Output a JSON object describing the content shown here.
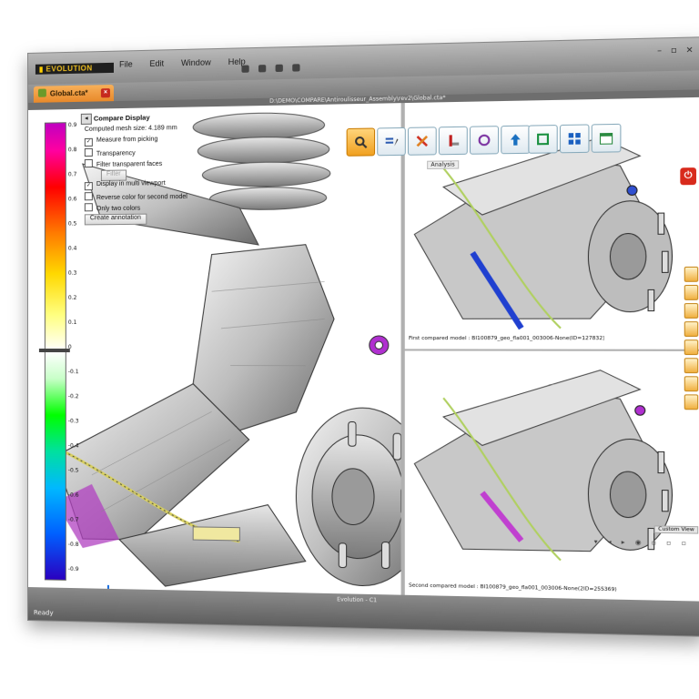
{
  "app": {
    "logo_text": "EVOLUTION",
    "menu": [
      "File",
      "Edit",
      "Window",
      "Help"
    ],
    "window_controls": "– ▫ ×"
  },
  "tab": {
    "label": "Global.cta*",
    "close": "×"
  },
  "path": "D:\\DEMO\\COMPARE\\Antiroulisseur_Assembly\\rev2\\Global.cta*",
  "colorbar": {
    "ticks": [
      "0.9",
      "0.8",
      "0.7",
      "0.6",
      "0.5",
      "0.4",
      "0.3",
      "0.2",
      "0.1",
      "0",
      "-0.1",
      "-0.2",
      "-0.3",
      "-0.4",
      "-0.5",
      "-0.6",
      "-0.7",
      "-0.8",
      "-0.9"
    ]
  },
  "compare_panel": {
    "title": "Compare Display",
    "mesh_size_label": "Computed mesh size:",
    "mesh_size_value": "4.189 mm",
    "measure_from_picking": "Measure from picking",
    "transparency": "Transparency",
    "filter_transparent": "Filter transparent faces",
    "filter_button": "Filter",
    "display_multi": "Display in multi viewport",
    "reverse_color": "Reverse color for second model",
    "only_two_colors": "Only two colors",
    "create_annotation": "Create annotation"
  },
  "toolbar": {
    "analysis_label": "Analysis"
  },
  "viewports": {
    "first_label": "First compared model : BI100879_geo_fla001_003006-None(ID=127832)",
    "second_label": "Second compared model : BI100879_geo_fla001_003006-None(2ID=255369)",
    "custom_view": "Custom View"
  },
  "status": {
    "window_title": "Evolution - C1",
    "ready": "Ready"
  },
  "colors": {
    "accent": "#f0a020",
    "power": "#d82a1c",
    "tab": "#e8892a"
  },
  "icons": [
    "zoom-icon",
    "annotate-icon",
    "tools-icon",
    "measure-icon",
    "rotate-icon",
    "export-icon",
    "frame-icon",
    "layout-icon",
    "calendar-icon",
    "power-icon"
  ]
}
